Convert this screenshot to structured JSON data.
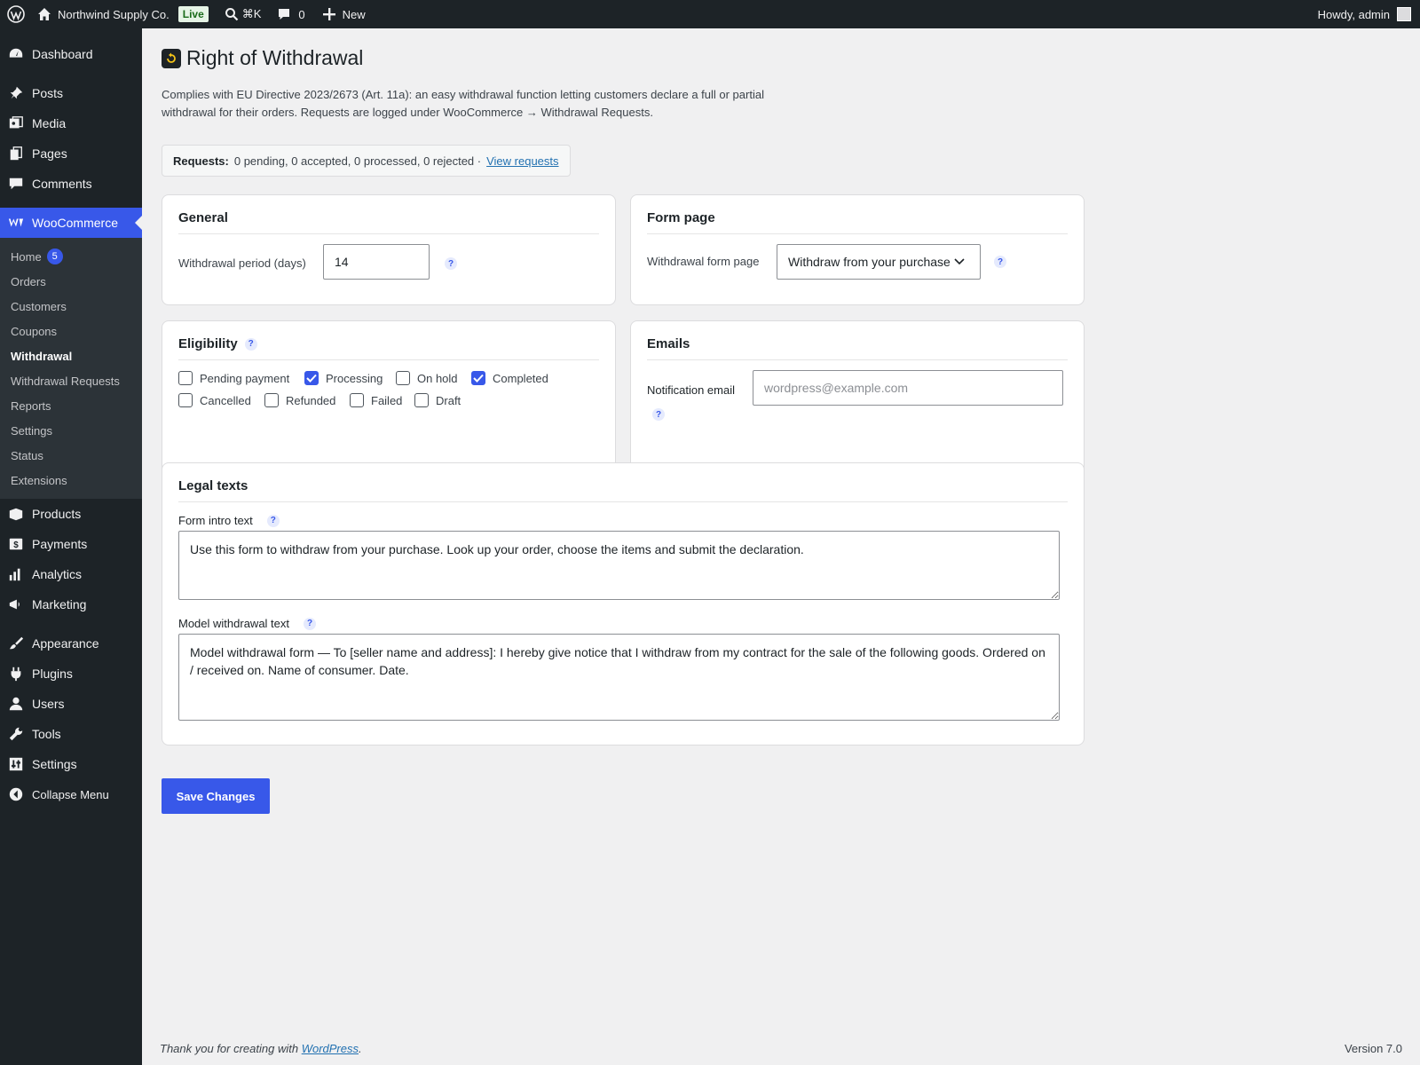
{
  "adminbar": {
    "site_name": "Northwind Supply Co.",
    "live_badge": "Live",
    "search_shortcut": "⌘K",
    "comments_count": "0",
    "new_label": "New",
    "howdy": "Howdy, admin"
  },
  "sidebar": {
    "dashboard": "Dashboard",
    "posts": "Posts",
    "media": "Media",
    "pages": "Pages",
    "comments": "Comments",
    "woocommerce": "WooCommerce",
    "sub": {
      "home": "Home",
      "home_count": "5",
      "orders": "Orders",
      "customers": "Customers",
      "coupons": "Coupons",
      "withdrawal": "Withdrawal",
      "withdrawal_requests": "Withdrawal Requests",
      "reports": "Reports",
      "settings": "Settings",
      "status": "Status",
      "extensions": "Extensions"
    },
    "products": "Products",
    "payments": "Payments",
    "analytics": "Analytics",
    "marketing": "Marketing",
    "appearance": "Appearance",
    "plugins": "Plugins",
    "users": "Users",
    "tools": "Tools",
    "settings": "Settings",
    "collapse": "Collapse Menu"
  },
  "page": {
    "title": "Right of Withdrawal",
    "intro_line1": "Complies with EU Directive 2023/2673 (Art. 11a): an easy withdrawal function letting customers declare a full or partial",
    "intro_line2": "withdrawal for their orders. Requests are logged under WooCommerce → Withdrawal Requests.",
    "summary_label": "Requests:",
    "summary_text": "0 pending, 0 accepted, 0 processed, 0 rejected ·",
    "summary_link": "View requests"
  },
  "general": {
    "title": "General",
    "period_label": "Withdrawal period (days)",
    "period_value": "14",
    "help": "?"
  },
  "form_page": {
    "title": "Form page",
    "label": "Withdrawal form page",
    "selected": "Withdraw from your purchase",
    "help": "?"
  },
  "eligibility": {
    "title": "Eligibility",
    "help": "?",
    "statuses": [
      {
        "label": "Pending payment",
        "checked": false
      },
      {
        "label": "Processing",
        "checked": true
      },
      {
        "label": "On hold",
        "checked": false
      },
      {
        "label": "Completed",
        "checked": true
      },
      {
        "label": "Cancelled",
        "checked": false
      },
      {
        "label": "Refunded",
        "checked": false
      },
      {
        "label": "Failed",
        "checked": false
      },
      {
        "label": "Draft",
        "checked": false
      }
    ]
  },
  "emails": {
    "title": "Emails",
    "label": "Notification email",
    "placeholder": "wordpress@example.com",
    "help": "?"
  },
  "legal": {
    "title": "Legal texts",
    "intro_label": "Form intro text",
    "intro_value": "Use this form to withdraw from your purchase. Look up your order, choose the items and submit the declaration.",
    "model_label": "Model withdrawal text",
    "model_value": "Model withdrawal form — To [seller name and address]: I hereby give notice that I withdraw from my contract for the sale of the following goods. Ordered on / received on. Name of consumer. Date.",
    "help": "?"
  },
  "save_label": "Save Changes",
  "footer": {
    "thanks_prefix": "Thank you for creating with ",
    "thanks_link": "WordPress",
    "thanks_suffix": ".",
    "version": "Version 7.0"
  },
  "colors": {
    "accent": "#3858e9",
    "adminbar_bg": "#1d2327",
    "page_bg": "#f0f0f1"
  }
}
